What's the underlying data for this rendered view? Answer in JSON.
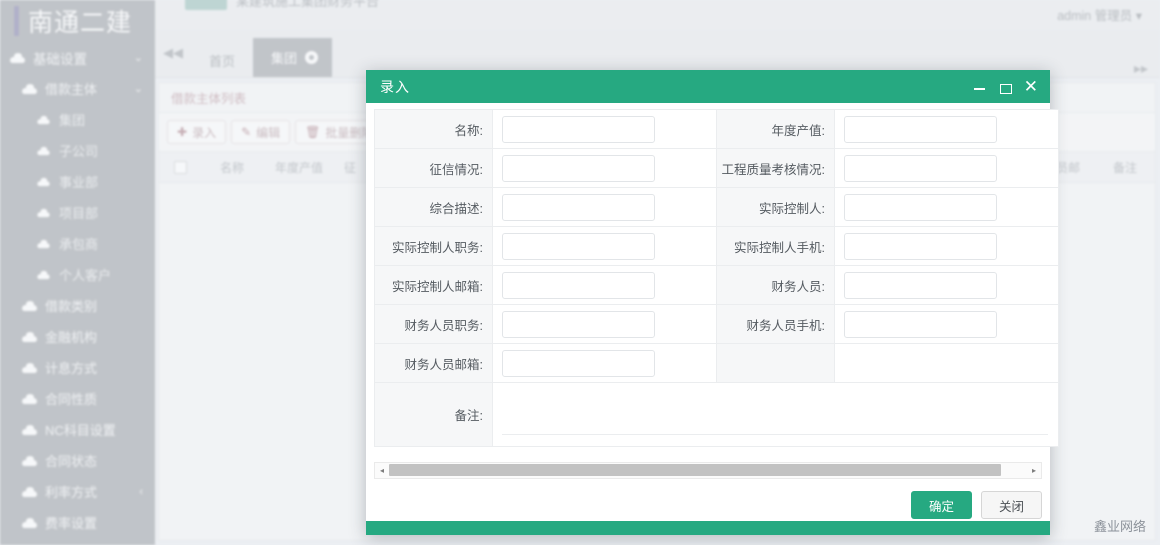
{
  "app": {
    "logo_text": "南通二建",
    "topbar_title": "某建筑施工集团财务平台",
    "user": "admin 管理员 ▾",
    "watermark": "鑫业网络",
    "colors": {
      "accent_green": "#26a981",
      "sidebar": "#98a2ad",
      "tab_active": "#9aa3ae",
      "toolbar_text": "#c98c99"
    }
  },
  "sidebar": {
    "items": [
      {
        "label": "基础设置",
        "level": 0,
        "chevron": "⌄"
      },
      {
        "label": "借款主体",
        "level": 1,
        "chevron": "⌄"
      },
      {
        "label": "集团",
        "level": 2,
        "chevron": ""
      },
      {
        "label": "子公司",
        "level": 2,
        "chevron": ""
      },
      {
        "label": "事业部",
        "level": 2,
        "chevron": ""
      },
      {
        "label": "项目部",
        "level": 2,
        "chevron": ""
      },
      {
        "label": "承包商",
        "level": 2,
        "chevron": ""
      },
      {
        "label": "个人客户",
        "level": 2,
        "chevron": ""
      },
      {
        "label": "借款类别",
        "level": 1,
        "chevron": ""
      },
      {
        "label": "金融机构",
        "level": 1,
        "chevron": ""
      },
      {
        "label": "计息方式",
        "level": 1,
        "chevron": ""
      },
      {
        "label": "合同性质",
        "level": 1,
        "chevron": ""
      },
      {
        "label": "NC科目设置",
        "level": 1,
        "chevron": ""
      },
      {
        "label": "合同状态",
        "level": 1,
        "chevron": ""
      },
      {
        "label": "利率方式",
        "level": 1,
        "chevron": "‹"
      },
      {
        "label": "费率设置",
        "level": 1,
        "chevron": ""
      }
    ]
  },
  "tabs": {
    "collapse_icon": "◀◀",
    "right_icon": "▸▸",
    "items": [
      {
        "label": "首页",
        "active": false,
        "closable": false
      },
      {
        "label": "集团",
        "active": true,
        "closable": true
      }
    ]
  },
  "panel": {
    "title": "借款主体列表",
    "toolbar": [
      {
        "icon": "✚",
        "label": "录入"
      },
      {
        "icon": "✎",
        "label": "编辑"
      },
      {
        "icon": "🗑",
        "label": "批量删除"
      },
      {
        "icon": "⟳",
        "label": ""
      }
    ],
    "table_headers": [
      {
        "label": "",
        "width": 42,
        "type": "checkbox"
      },
      {
        "label": "名称",
        "width": 62
      },
      {
        "label": "年度产值",
        "width": 72
      },
      {
        "label": "征",
        "width": 30
      },
      {
        "label": "务人员邮",
        "width": 78
      },
      {
        "label": "备注",
        "width": 60
      }
    ]
  },
  "modal": {
    "title": "录入",
    "controls": {
      "minimize": "minimize-icon",
      "maximize": "maximize-icon",
      "close": "✕"
    },
    "rows": [
      {
        "left_label": "名称:",
        "left_value": "",
        "right_label": "年度产值:",
        "right_value": ""
      },
      {
        "left_label": "征信情况:",
        "left_value": "",
        "right_label": "工程质量考核情况:",
        "right_value": ""
      },
      {
        "left_label": "综合描述:",
        "left_value": "",
        "right_label": "实际控制人:",
        "right_value": ""
      },
      {
        "left_label": "实际控制人职务:",
        "left_value": "",
        "right_label": "实际控制人手机:",
        "right_value": ""
      },
      {
        "left_label": "实际控制人邮箱:",
        "left_value": "",
        "right_label": "财务人员:",
        "right_value": ""
      },
      {
        "left_label": "财务人员职务:",
        "left_value": "",
        "right_label": "财务人员手机:",
        "right_value": ""
      },
      {
        "left_label": "财务人员邮箱:",
        "left_value": "",
        "right_label": "",
        "right_value": null
      }
    ],
    "note": {
      "label": "备注:",
      "value": ""
    },
    "scrollbar": {
      "left_arrow": "◂",
      "right_arrow": "▸",
      "thumb_pct": 96
    },
    "buttons": {
      "ok": "确定",
      "cancel": "关闭"
    }
  }
}
